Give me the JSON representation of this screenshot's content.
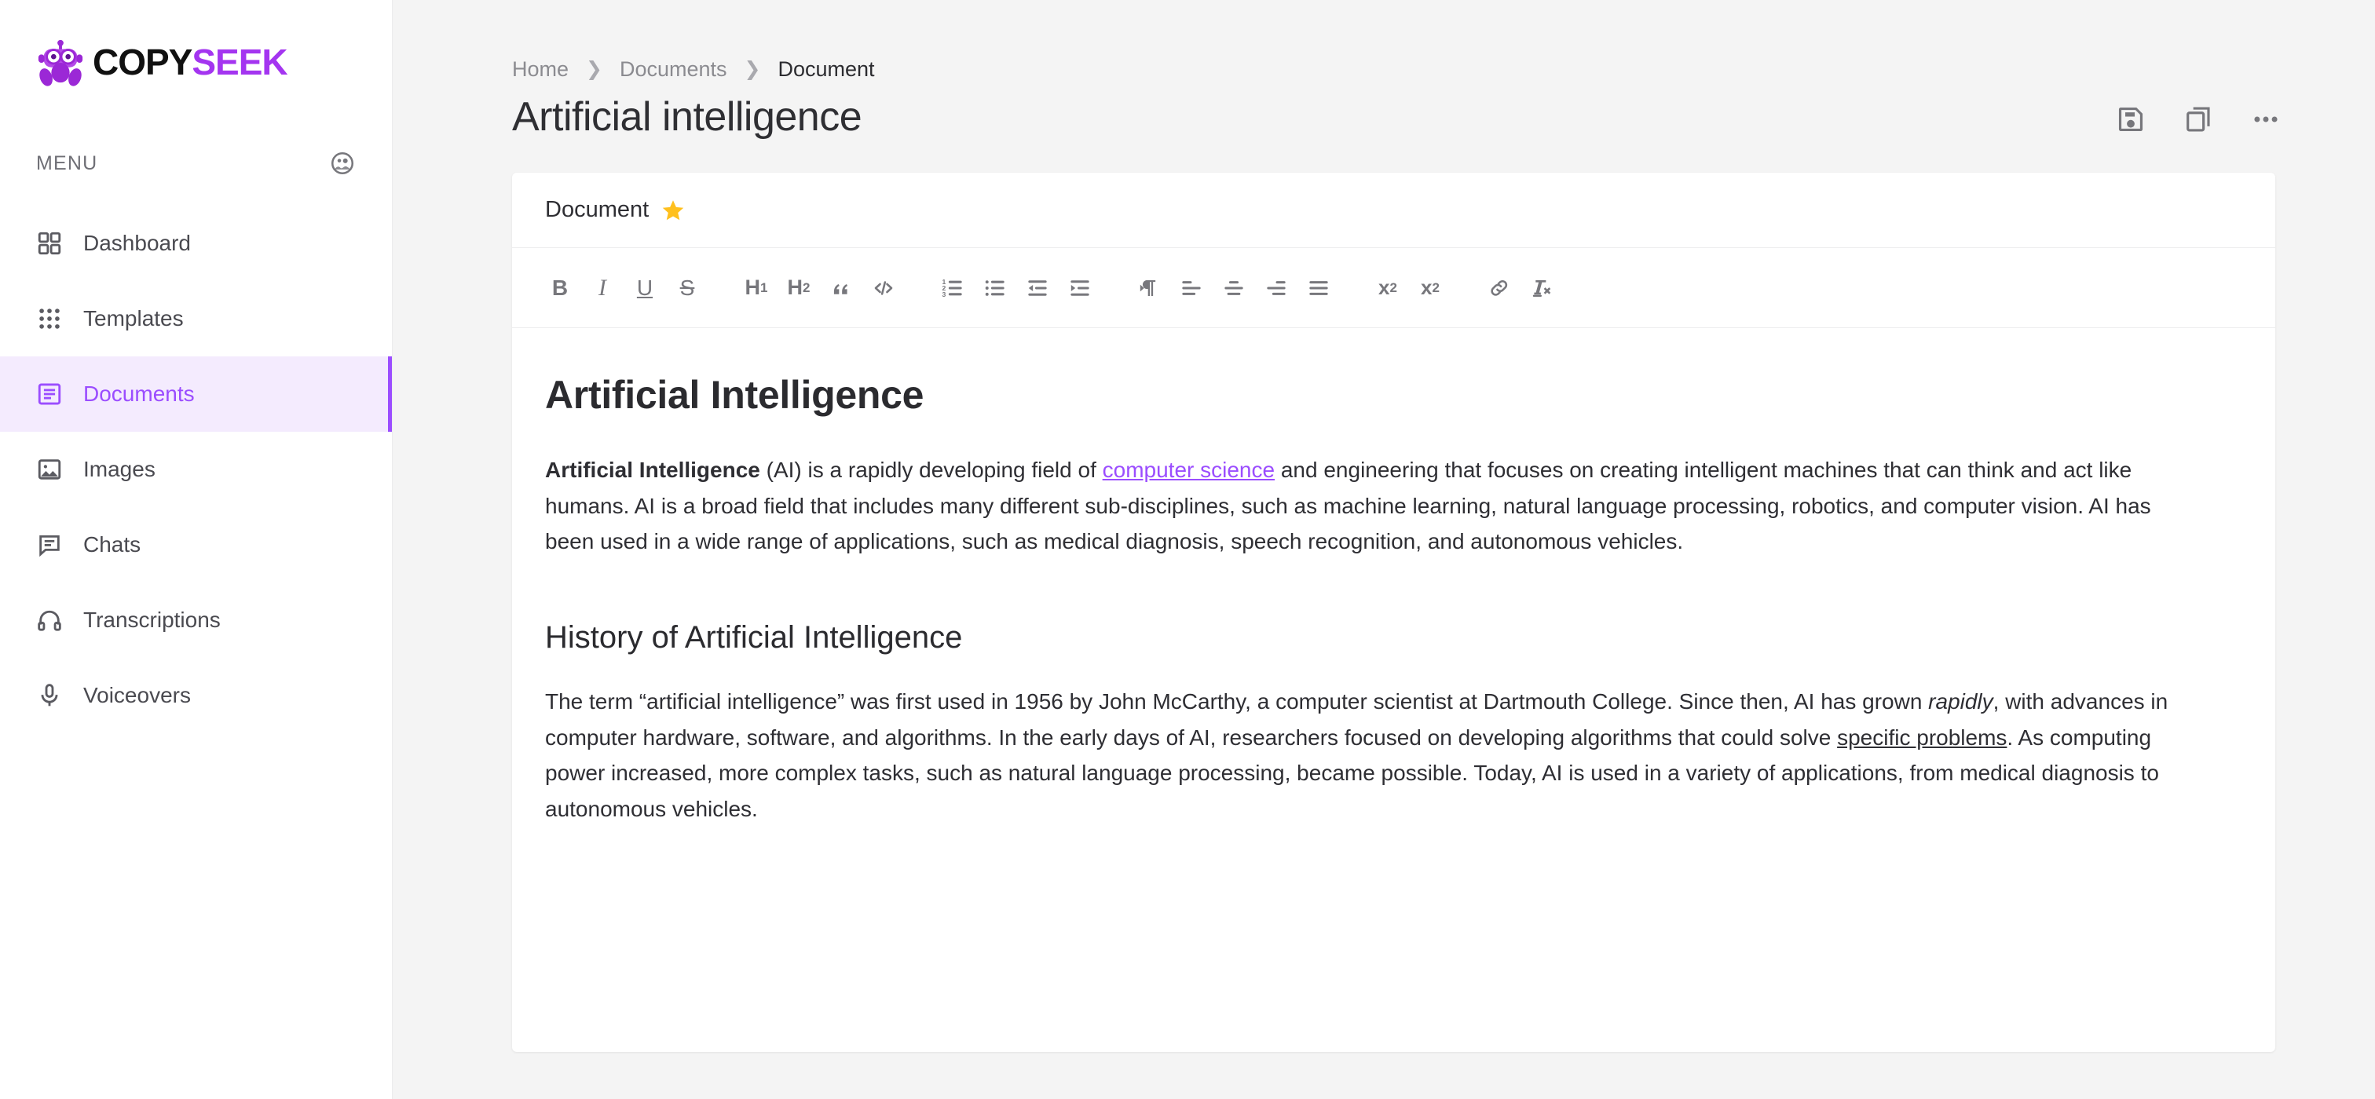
{
  "brand": {
    "copy": "COPY",
    "seek": "SEEK",
    "logo_icon": "robot-icon"
  },
  "sidebar": {
    "menu_label": "MENU",
    "menu_head_icon": "collapse-avatar-icon",
    "items": [
      {
        "label": "Dashboard",
        "icon": "grid-squares-icon",
        "active": false
      },
      {
        "label": "Templates",
        "icon": "dots-grid-icon",
        "active": false
      },
      {
        "label": "Documents",
        "icon": "document-lines-icon",
        "active": true
      },
      {
        "label": "Images",
        "icon": "image-icon",
        "active": false
      },
      {
        "label": "Chats",
        "icon": "chat-bubble-icon",
        "active": false
      },
      {
        "label": "Transcriptions",
        "icon": "headphones-icon",
        "active": false
      },
      {
        "label": "Voiceovers",
        "icon": "microphone-icon",
        "active": false
      }
    ]
  },
  "breadcrumb": [
    {
      "label": "Home",
      "current": false
    },
    {
      "label": "Documents",
      "current": false
    },
    {
      "label": "Document",
      "current": true
    }
  ],
  "header": {
    "page_title": "Artificial intelligence",
    "actions": [
      {
        "name": "save-button",
        "icon": "floppy-save-icon"
      },
      {
        "name": "copy-button",
        "icon": "copy-icon"
      },
      {
        "name": "more-button",
        "icon": "ellipsis-icon"
      }
    ]
  },
  "document_card": {
    "tab_label": "Document",
    "starred": true,
    "star_icon": "star-filled-icon",
    "toolbar": [
      {
        "name": "bold-button",
        "glyph": "B",
        "icon": "bold-icon"
      },
      {
        "name": "italic-button",
        "glyph": "I",
        "icon": "italic-icon"
      },
      {
        "name": "underline-button",
        "glyph": "U",
        "icon": "underline-icon"
      },
      {
        "name": "strikethrough-button",
        "glyph": "S",
        "icon": "strikethrough-icon"
      },
      {
        "name": "heading-1-button",
        "glyph": "H1",
        "icon": "heading-1-icon"
      },
      {
        "name": "heading-2-button",
        "glyph": "H2",
        "icon": "heading-2-icon"
      },
      {
        "name": "blockquote-button",
        "glyph": "”",
        "icon": "quote-icon"
      },
      {
        "name": "code-block-button",
        "glyph": "</>",
        "icon": "code-icon"
      },
      {
        "name": "ordered-list-button",
        "glyph": "",
        "icon": "numbered-list-icon"
      },
      {
        "name": "bullet-list-button",
        "glyph": "",
        "icon": "bullet-list-icon"
      },
      {
        "name": "outdent-button",
        "glyph": "",
        "icon": "outdent-icon"
      },
      {
        "name": "indent-button",
        "glyph": "",
        "icon": "indent-icon"
      },
      {
        "name": "text-direction-button",
        "glyph": "¶",
        "icon": "paragraph-direction-icon"
      },
      {
        "name": "align-left-button",
        "glyph": "",
        "icon": "align-left-icon"
      },
      {
        "name": "align-center-button",
        "glyph": "",
        "icon": "align-center-icon"
      },
      {
        "name": "align-right-button",
        "glyph": "",
        "icon": "align-right-icon"
      },
      {
        "name": "align-justify-button",
        "glyph": "",
        "icon": "align-justify-icon"
      },
      {
        "name": "subscript-button",
        "glyph": "x2",
        "icon": "subscript-icon"
      },
      {
        "name": "superscript-button",
        "glyph": "x2",
        "icon": "superscript-icon"
      },
      {
        "name": "insert-link-button",
        "glyph": "",
        "icon": "link-chain-icon"
      },
      {
        "name": "clear-format-button",
        "glyph": "Tx",
        "icon": "clear-formatting-icon"
      }
    ],
    "content": {
      "h1": "Artificial Intelligence",
      "p1_bold": "Artificial Intelligence",
      "p1_before_link": " (AI) is a rapidly developing field of ",
      "p1_link": "computer science",
      "p1_after_link": " and engineering that focuses on creating intelligent machines that can think and act like humans. AI is a broad field that includes many different sub-disciplines, such as machine learning, natural language processing, robotics, and computer vision. AI has been used in a wide range of applications, such as medical diagnosis, speech recognition, and autonomous vehicles.",
      "h2": "History of Artificial Intelligence",
      "p2_a": "The term “artificial intelligence” was first used in 1956 by John McCarthy, a computer scientist at Dartmouth College. Since then, AI has grown ",
      "p2_italic": "rapidly",
      "p2_b": ", with advances in computer hardware, software, and algorithms. In the early days of AI, researchers focused on developing algorithms that could solve ",
      "p2_underline": "specific problems",
      "p2_c": ". As computing power increased, more complex tasks, such as natural language processing, became possible. Today, AI is used in a variety of applications, from medical diagnosis to autonomous vehicles."
    }
  },
  "colors": {
    "accent_purple": "#9b4dff",
    "brand_purple": "#a435f0",
    "active_bg": "#f4ebfe",
    "star_gold": "#ffc01e",
    "canvas_bg": "#f4f4f4"
  }
}
